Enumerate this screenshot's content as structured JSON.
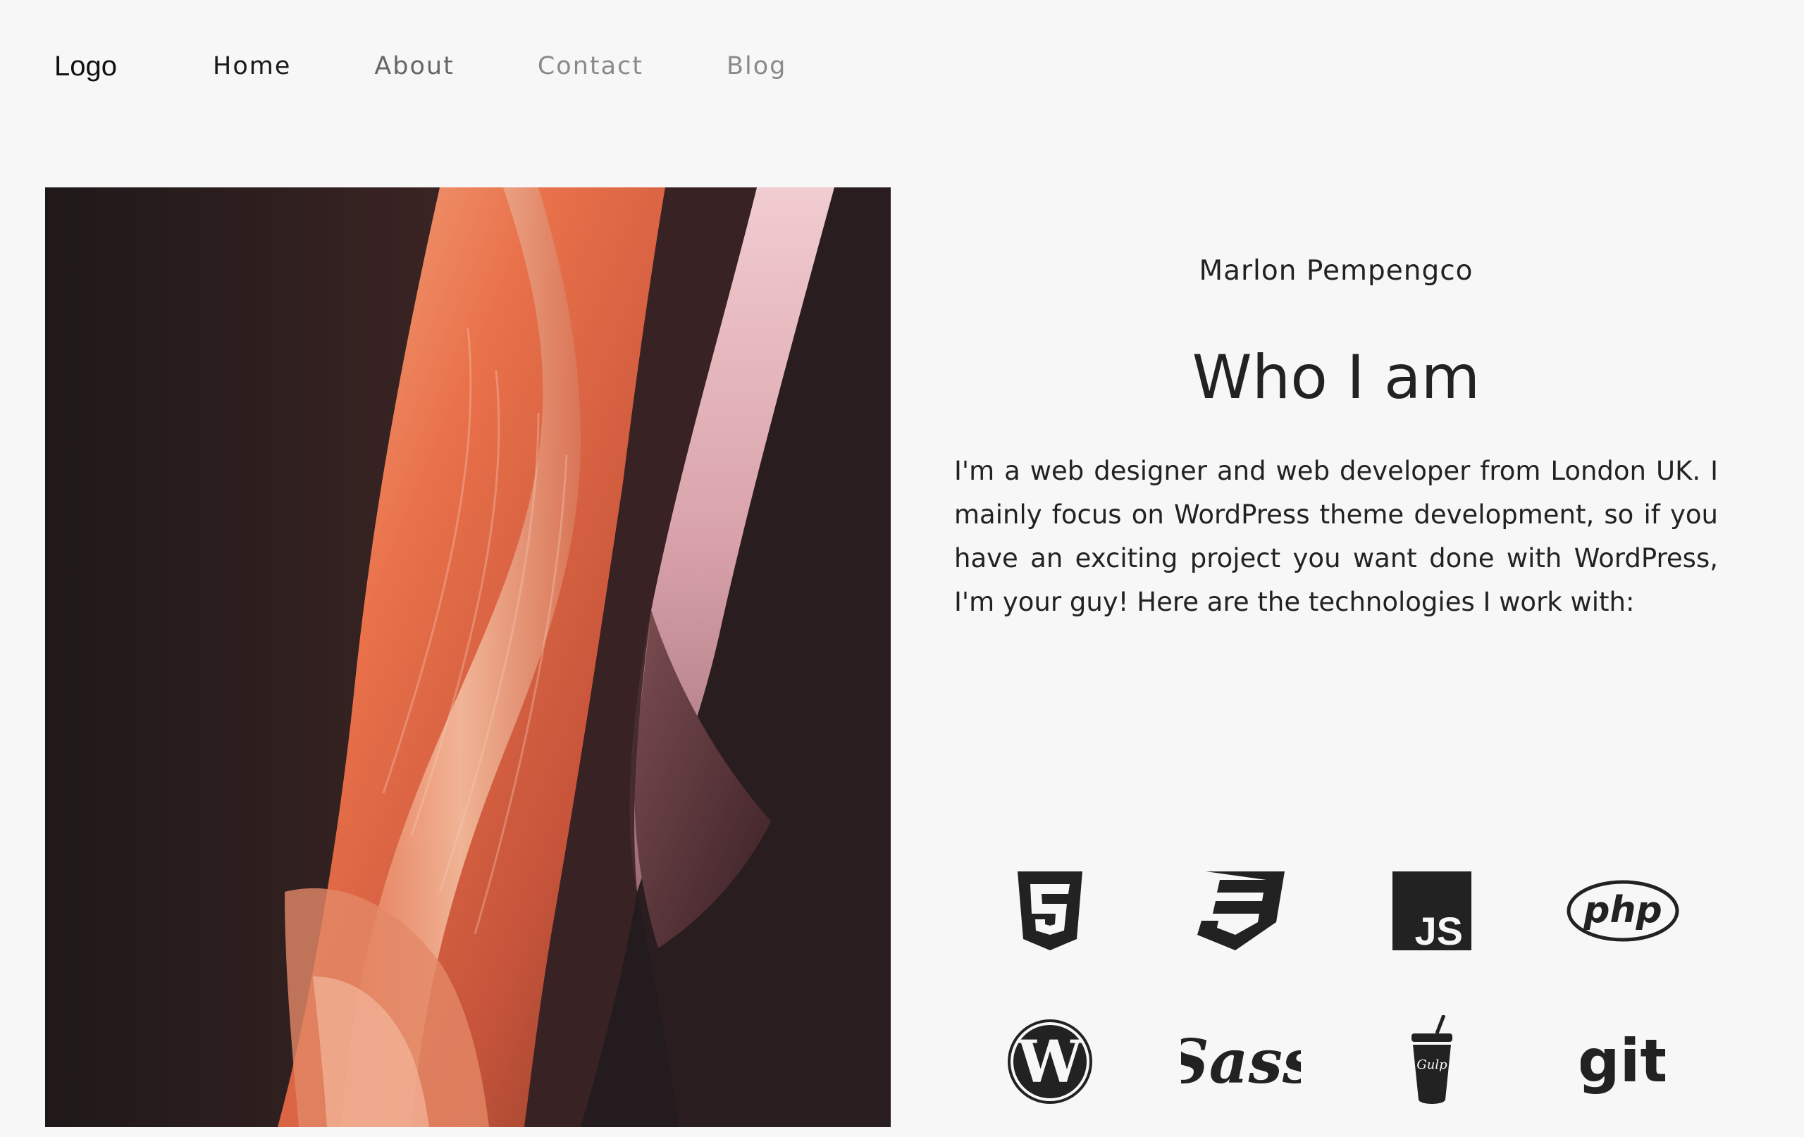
{
  "nav": {
    "logo": "Logo",
    "links": [
      {
        "label": "Home"
      },
      {
        "label": "About"
      },
      {
        "label": "Contact"
      },
      {
        "label": "Blog"
      }
    ]
  },
  "hero": {
    "image": "canyon-photo"
  },
  "about": {
    "name": "Marlon Pempengco",
    "heading": "Who I am",
    "bio": "I'm a web designer and web developer from London UK. I mainly focus on WordPress theme development, so if you have an exciting project you want done with WordPress, I'm your guy! Here are the technologies I work with:"
  },
  "technologies": [
    {
      "name": "html5",
      "icon": "html5-icon",
      "text": "5"
    },
    {
      "name": "css3",
      "icon": "css3-icon",
      "text": "3"
    },
    {
      "name": "javascript",
      "icon": "javascript-icon",
      "text": "JS"
    },
    {
      "name": "php",
      "icon": "php-icon",
      "text": "php"
    },
    {
      "name": "wordpress",
      "icon": "wordpress-icon",
      "text": "W"
    },
    {
      "name": "sass",
      "icon": "sass-icon",
      "text": "Sass"
    },
    {
      "name": "gulp",
      "icon": "gulp-icon",
      "text": "Gulp"
    },
    {
      "name": "git",
      "icon": "git-icon",
      "text": "git"
    }
  ],
  "colors": {
    "background": "#f7f7f7",
    "text": "#222222",
    "icon": "#222222"
  }
}
